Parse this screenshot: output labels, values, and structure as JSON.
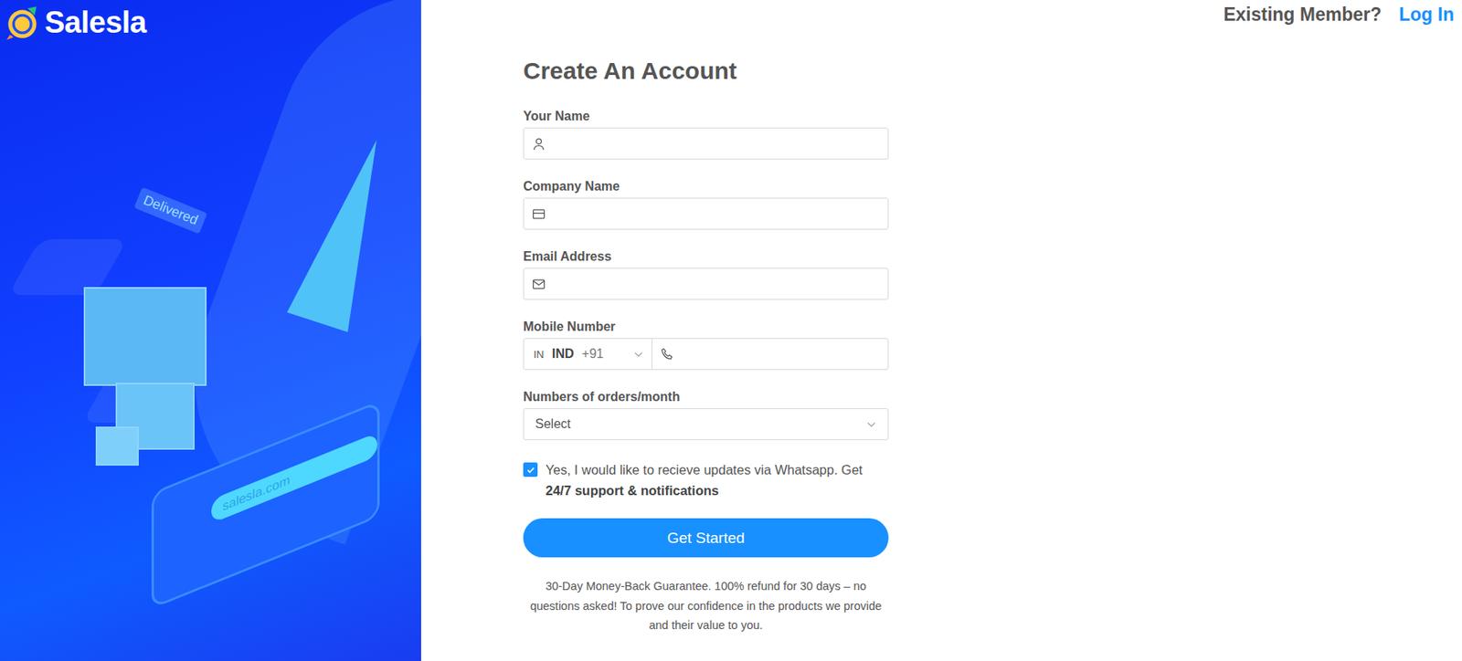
{
  "logo": {
    "text": "Salesla"
  },
  "illustration": {
    "labels": [
      "Delivered",
      "salesla.com"
    ]
  },
  "header": {
    "prompt": "Existing Member?",
    "link": "Log In"
  },
  "form": {
    "title": "Create An Account",
    "fields": [
      {
        "label": "Your Name",
        "kind": "text",
        "value": ""
      },
      {
        "label": "Company Name",
        "kind": "text",
        "value": ""
      },
      {
        "label": "Email Address",
        "kind": "text",
        "value": ""
      },
      {
        "label": "Mobile Number",
        "kind": "phone",
        "country_code": "IN",
        "country": "IND",
        "dial": "+91",
        "value": ""
      },
      {
        "label": "Numbers of orders/month",
        "kind": "select",
        "value": "Select"
      }
    ],
    "consent": {
      "checked": true,
      "text": "Yes, I would like to recieve updates via Whatsapp. Get ",
      "bold": "24/7 support & notifications"
    },
    "button": "Get Started",
    "note": "30-Day Money-Back Guarantee. 100% refund for 30 days – no questions asked! To prove our confidence in the products we provide and their value to you."
  }
}
